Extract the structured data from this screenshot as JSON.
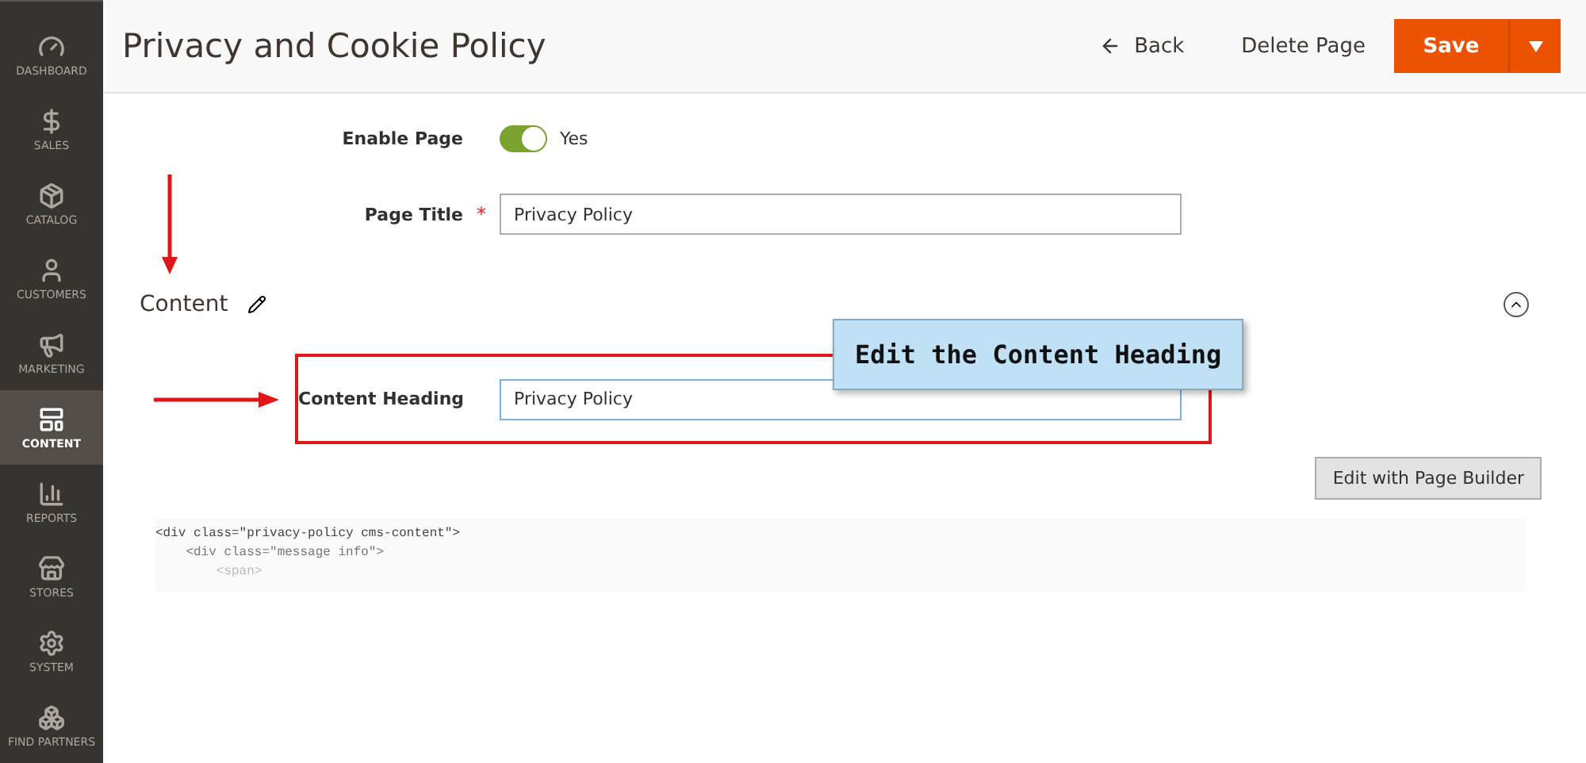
{
  "sidebar": {
    "items": [
      {
        "label": "DASHBOARD",
        "selected": false
      },
      {
        "label": "SALES",
        "selected": false
      },
      {
        "label": "CATALOG",
        "selected": false
      },
      {
        "label": "CUSTOMERS",
        "selected": false
      },
      {
        "label": "MARKETING",
        "selected": false
      },
      {
        "label": "CONTENT",
        "selected": true
      },
      {
        "label": "REPORTS",
        "selected": false
      },
      {
        "label": "STORES",
        "selected": false
      },
      {
        "label": "SYSTEM",
        "selected": false
      },
      {
        "label": "FIND PARTNERS",
        "selected": false
      }
    ]
  },
  "header": {
    "title": "Privacy and Cookie Policy",
    "back": "Back",
    "delete": "Delete Page",
    "save": "Save"
  },
  "form": {
    "enable_label": "Enable Page",
    "enable_on": true,
    "enable_value": "Yes",
    "title_label": "Page Title",
    "title_required_mark": "*",
    "title_value": "Privacy Policy"
  },
  "content": {
    "heading": "Content",
    "expanded": true,
    "heading_label": "Content Heading",
    "heading_value": "Privacy Policy",
    "builder_button": "Edit with Page Builder",
    "code_lines": [
      "<div class=\"privacy-policy cms-content\">",
      "    <div class=\"message info\">",
      "        <span>"
    ]
  },
  "annotation": {
    "callout": "Edit the Content Heading"
  }
}
